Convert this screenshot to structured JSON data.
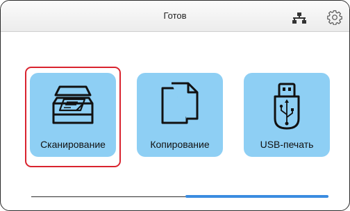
{
  "header": {
    "status_text": "Готов",
    "icons": [
      "network-icon",
      "gear-icon"
    ]
  },
  "tiles": [
    {
      "label": "Сканирование",
      "icon": "scanner-icon",
      "selected": true
    },
    {
      "label": "Копирование",
      "icon": "copy-documents-icon",
      "selected": false
    },
    {
      "label": "USB-печать",
      "icon": "usb-drive-icon",
      "selected": false
    }
  ],
  "pager": {
    "current_page": 2,
    "total_pages": 2
  },
  "colors": {
    "tile_background": "#8ecff4",
    "selection_frame": "#d9232e",
    "pager_active": "#3a8ce0"
  }
}
